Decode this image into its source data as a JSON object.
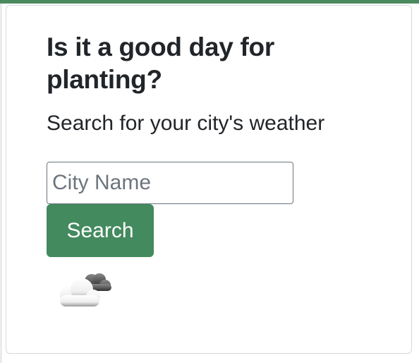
{
  "card": {
    "title": "Is it a good day for planting?",
    "subtitle": "Search for your city's weather"
  },
  "search": {
    "placeholder": "City Name",
    "value": "",
    "button_label": "Search"
  },
  "weather": {
    "icon": "cloudy-icon"
  },
  "colors": {
    "accent": "#438a5e",
    "top_bar": "#4a8a5e",
    "card_border": "#d6d8db",
    "text": "#212529"
  }
}
